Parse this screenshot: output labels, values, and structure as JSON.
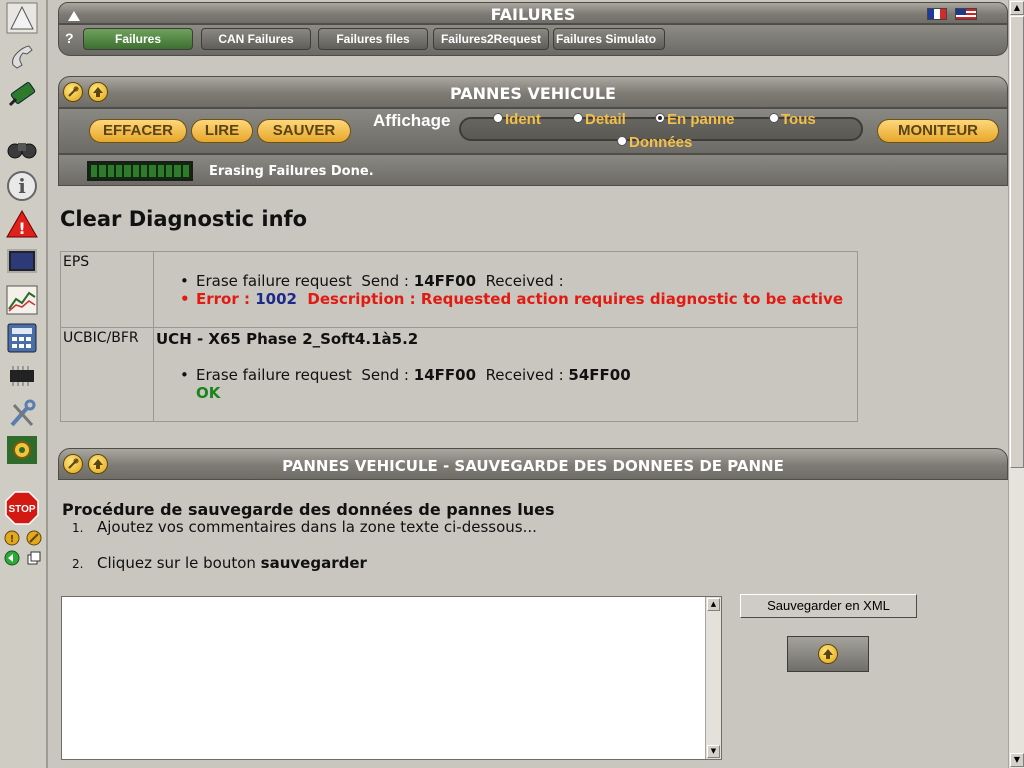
{
  "window": {
    "title": "FAILURES",
    "help_label": "?",
    "tabs": [
      {
        "label": "Failures",
        "active": true
      },
      {
        "label": "CAN Failures",
        "active": false
      },
      {
        "label": "Failures files",
        "active": false
      },
      {
        "label": "Failures2Request",
        "active": false
      },
      {
        "label": "Failures Simulato",
        "active": false
      }
    ],
    "languages": [
      "french-flag-icon",
      "us-flag-icon"
    ]
  },
  "sidebar": {
    "icons": [
      "up-arrow-icon",
      "phone-icon",
      "cable-connector-icon",
      "binoculars-icon",
      "info-icon",
      "warning-icon",
      "monitor-icon",
      "chart-icon",
      "calculator-icon",
      "chip-icon",
      "tools-icon",
      "gear-icon",
      "stop-icon",
      "small-coin-icon",
      "small-wrench-icon",
      "back-arrow-icon",
      "copy-icon"
    ],
    "stop_label": "STOP"
  },
  "failures_panel": {
    "title": "PANNES VEHICULE",
    "buttons": {
      "erase": "EFFACER",
      "read": "LIRE",
      "save": "SAUVER",
      "monitor": "MONITEUR"
    },
    "display_label": "Affichage",
    "display_options": [
      {
        "label": "Ident",
        "selected": false
      },
      {
        "label": "Detail",
        "selected": false
      },
      {
        "label": "En panne",
        "selected": true
      },
      {
        "label": "Tous",
        "selected": false
      },
      {
        "label": "Données",
        "selected": false
      }
    ]
  },
  "status": {
    "text": "Erasing Failures Done.",
    "progress_segments": 12
  },
  "diagnostic": {
    "title": "Clear Diagnostic info",
    "rows": [
      {
        "ecu": "EPS",
        "heading": "",
        "request_label": "Erase failure request",
        "send_label": "Send :",
        "send_value": "14FF00",
        "received_label": "Received :",
        "received_value": "",
        "error_label": "Error :",
        "error_code": "1002",
        "description_label": "Description :",
        "description": "Requested action requires diagnostic to be active"
      },
      {
        "ecu": "UCBIC/BFR",
        "heading": "UCH - X65 Phase 2_Soft4.1à5.2",
        "request_label": "Erase failure request",
        "send_label": "Send :",
        "send_value": "14FF00",
        "received_label": "Received :",
        "received_value": "54FF00",
        "result": "OK"
      }
    ]
  },
  "save_panel": {
    "title": "PANNES VEHICULE - SAUVEGARDE DES DONNEES DE PANNE",
    "procedure_title": "Procédure de sauvegarde des données de pannes lues",
    "steps": [
      {
        "num": "1.",
        "text": "Ajoutez vos commentaires dans la zone texte ci-dessous...",
        "bold": ""
      },
      {
        "num": "2.",
        "text": "Cliquez sur le bouton ",
        "bold": "sauvegarder"
      }
    ],
    "comment_value": "",
    "save_xml_label": "Sauvegarder en XML"
  }
}
